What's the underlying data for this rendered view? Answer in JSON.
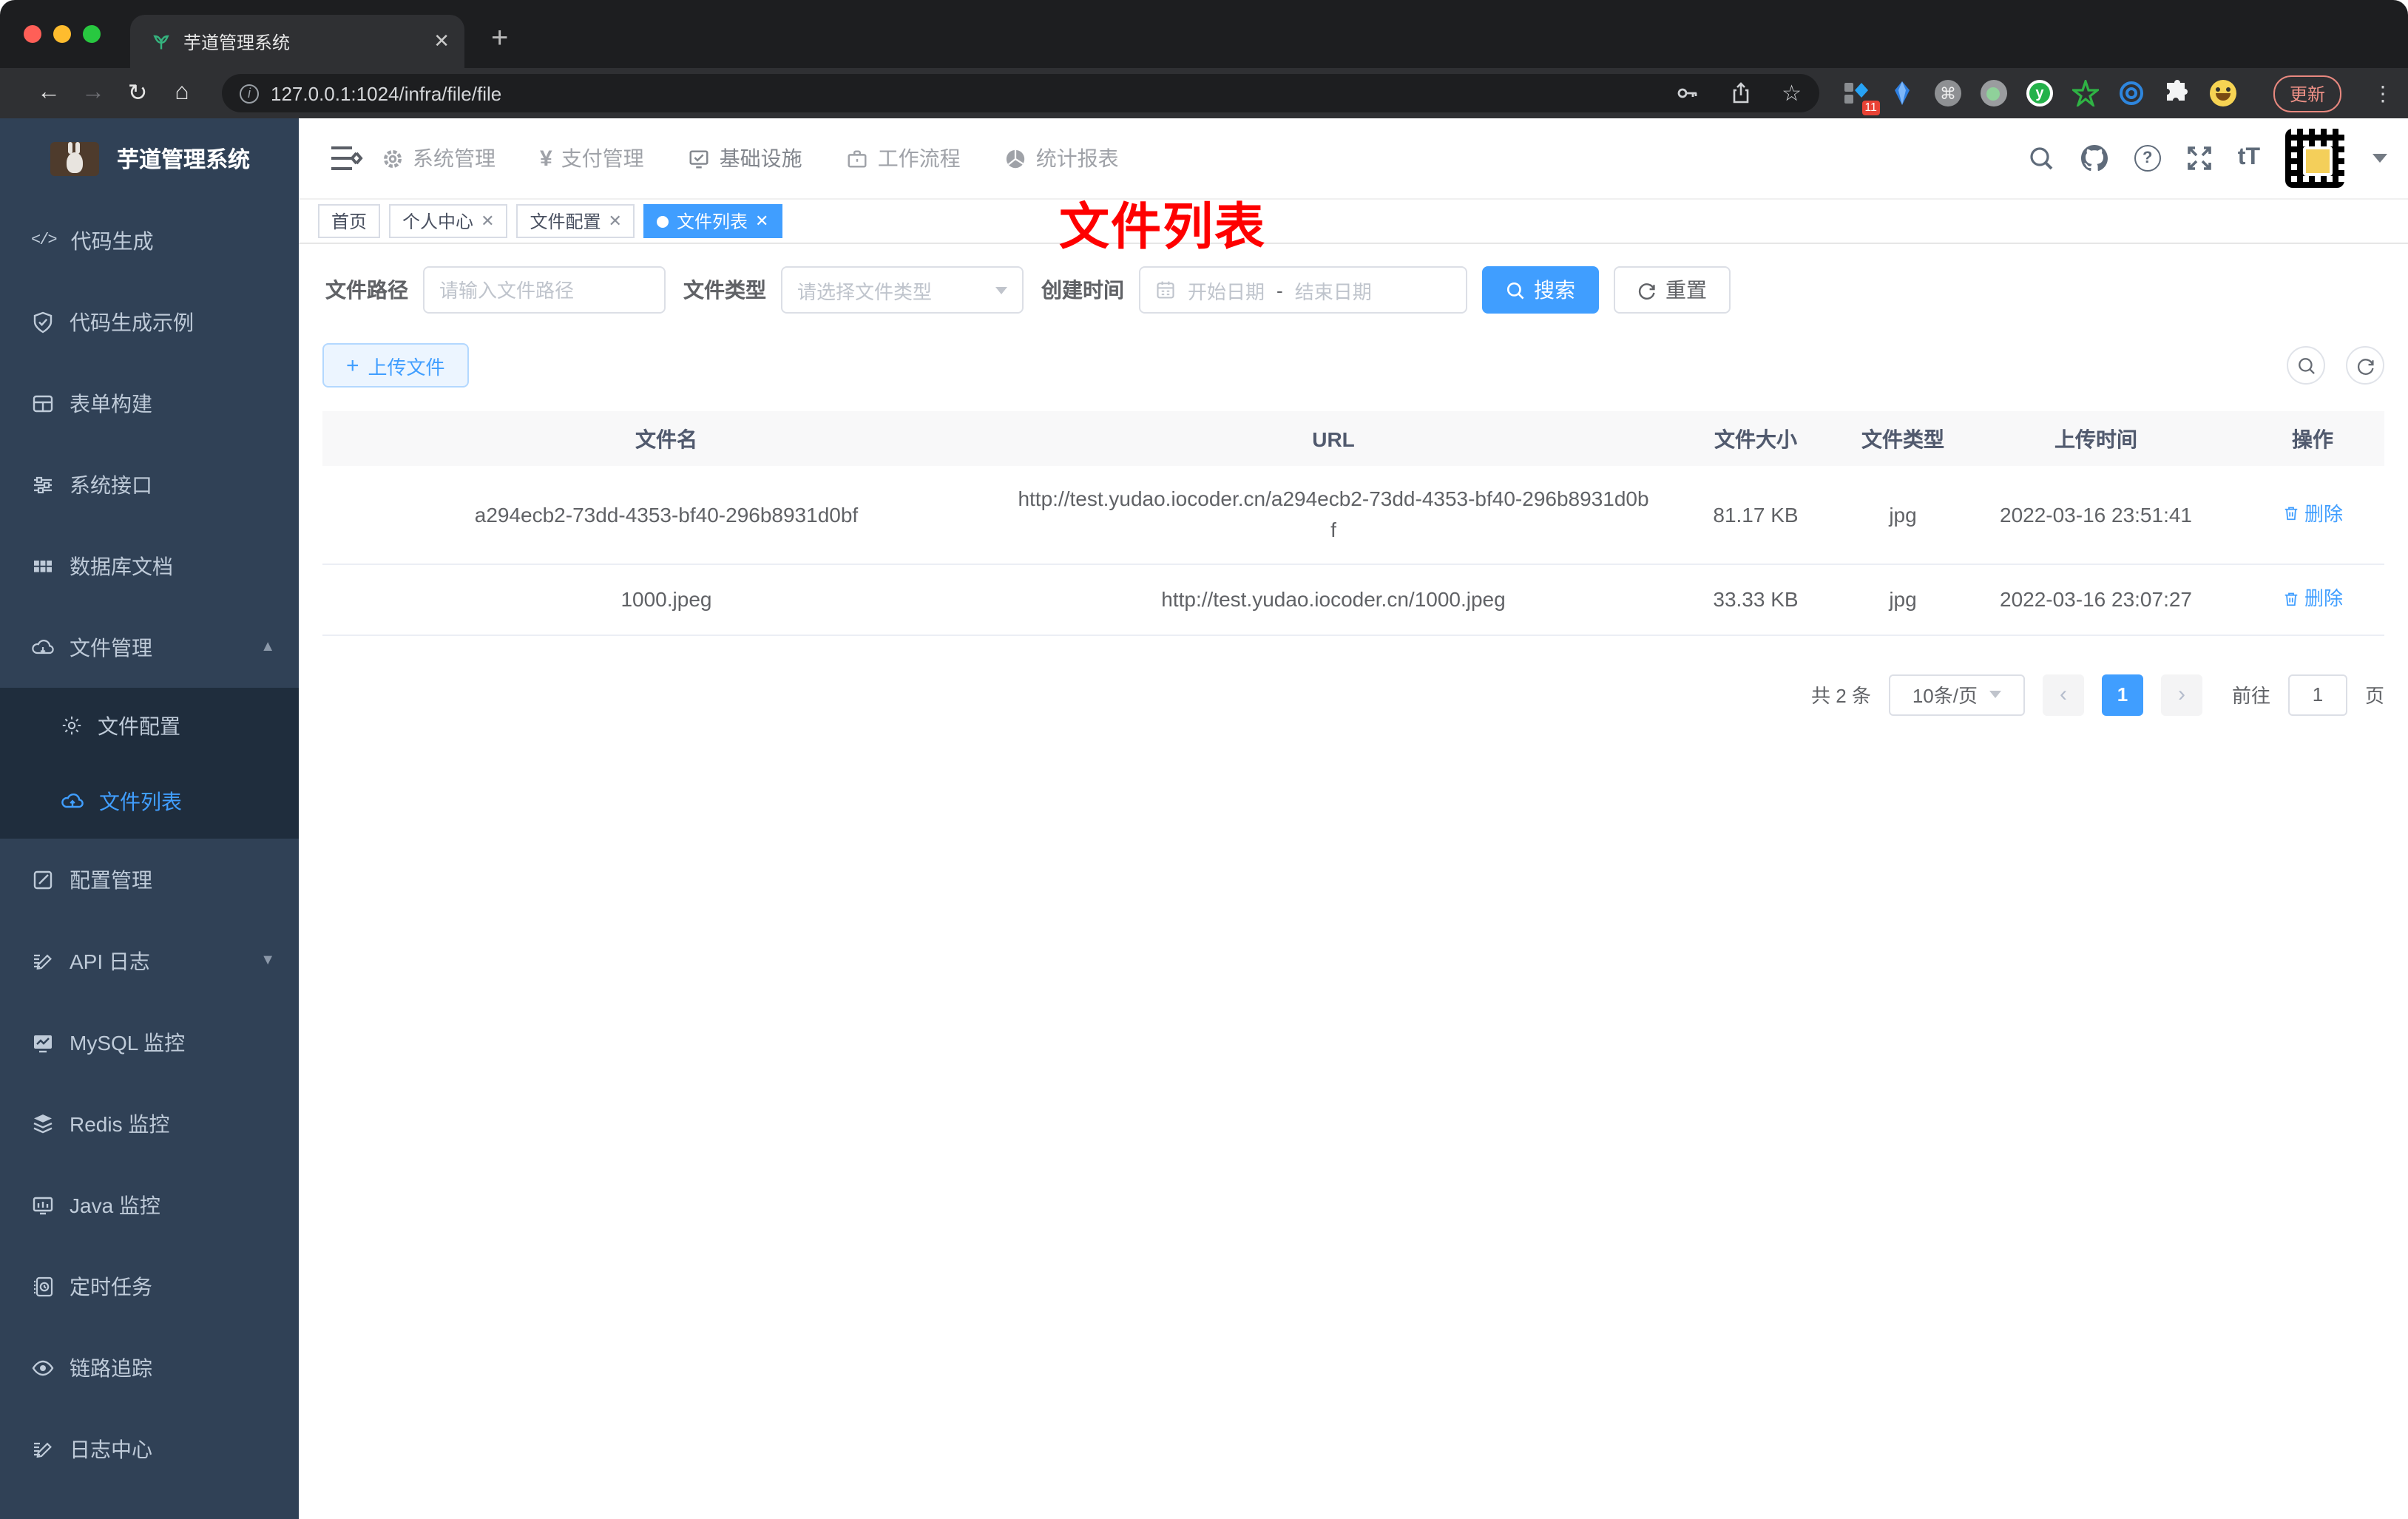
{
  "browser": {
    "tab_title": "芋道管理系统",
    "close_glyph": "✕",
    "newtab_glyph": "+",
    "back_glyph": "←",
    "forward_glyph": "→",
    "reload_glyph": "↻",
    "home_glyph": "⌂",
    "url": "127.0.0.1:1024/infra/file/file",
    "info_glyph": "i",
    "star_glyph": "☆",
    "cmd_glyph": "⌘",
    "extension_badge": "11",
    "update_label": "更新",
    "dots_glyph": "⋮"
  },
  "sidebar": {
    "logo_title": "芋道管理系统",
    "items_top": [
      {
        "label": "代码生成"
      },
      {
        "label": "代码生成示例"
      },
      {
        "label": "表单构建"
      },
      {
        "label": "系统接口"
      },
      {
        "label": "数据库文档"
      },
      {
        "label": "文件管理"
      }
    ],
    "submenu": [
      {
        "label": "文件配置"
      },
      {
        "label": "文件列表",
        "active": true
      }
    ],
    "items_bottom": [
      {
        "label": "配置管理"
      },
      {
        "label": "API 日志"
      },
      {
        "label": "MySQL 监控"
      },
      {
        "label": "Redis 监控"
      },
      {
        "label": "Java 监控"
      },
      {
        "label": "定时任务"
      },
      {
        "label": "链路追踪"
      },
      {
        "label": "日志中心"
      }
    ],
    "code_icon_glyph": "</>"
  },
  "topnav": {
    "items": [
      {
        "label": "系统管理"
      },
      {
        "label": "支付管理"
      },
      {
        "label": "基础设施",
        "active": true
      },
      {
        "label": "工作流程"
      },
      {
        "label": "统计报表"
      }
    ],
    "yen_glyph": "¥",
    "font_size_glyph": "tT",
    "help_glyph": "?"
  },
  "tags": [
    {
      "label": "首页",
      "closable": false
    },
    {
      "label": "个人中心",
      "closable": true
    },
    {
      "label": "文件配置",
      "closable": true
    },
    {
      "label": "文件列表",
      "closable": true,
      "active": true
    }
  ],
  "annotation": {
    "text": "文件列表"
  },
  "filters": {
    "path_label": "文件路径",
    "path_placeholder": "请输入文件路径",
    "type_label": "文件类型",
    "type_placeholder": "请选择文件类型",
    "date_label": "创建时间",
    "date_start": "开始日期",
    "date_separator": "-",
    "date_end": "结束日期",
    "search_label": "搜索",
    "reset_label": "重置"
  },
  "toolbar": {
    "upload_label": "上传文件",
    "plus_glyph": "+"
  },
  "table": {
    "headers": [
      "文件名",
      "URL",
      "文件大小",
      "文件类型",
      "上传时间",
      "操作"
    ],
    "rows": [
      {
        "name": "a294ecb2-73dd-4353-bf40-296b8931d0bf",
        "url": "http://test.yudao.iocoder.cn/a294ecb2-73dd-4353-bf40-296b8931d0bf",
        "size": "81.17 KB",
        "type": "jpg",
        "time": "2022-03-16 23:51:41",
        "action": "删除"
      },
      {
        "name": "1000.jpeg",
        "url": "http://test.yudao.iocoder.cn/1000.jpeg",
        "size": "33.33 KB",
        "type": "jpg",
        "time": "2022-03-16 23:07:27",
        "action": "删除"
      }
    ]
  },
  "pagination": {
    "total": "共 2 条",
    "page_size": "10条/页",
    "prev_glyph": "‹",
    "next_glyph": "›",
    "current_page": "1",
    "goto_label": "前往",
    "goto_value": "1",
    "unit_label": "页"
  },
  "colors": {
    "primary": "#409eff",
    "sidebar_bg": "#304156",
    "submenu_bg": "#1f2d3d",
    "sidebar_text": "#bfcbd9",
    "annotation_red": "#fe0000",
    "table_header_bg": "#f8f8f9",
    "update_button": "#e8887f"
  }
}
